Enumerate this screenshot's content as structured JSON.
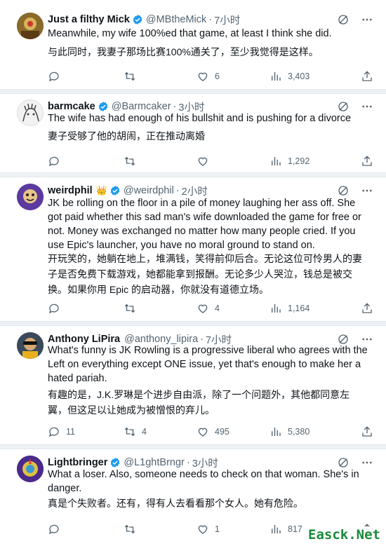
{
  "tweets": [
    {
      "name": "Just a filthy Mick",
      "handle": "@MBtheMick",
      "time": "7小时",
      "text": "Meanwhile, my wife 100%ed that game, at least I think she did.",
      "translation": "与此同时，我妻子那场比赛100%通关了，至少我觉得是这样。",
      "replies": "",
      "retweets": "",
      "likes": "6",
      "views": "3,403"
    },
    {
      "name": "barmcake",
      "handle": "@Barmcaker",
      "time": "3小时",
      "text": "The wife has had enough of his bullshit and is pushing for a divorce",
      "translation": "妻子受够了他的胡闹，正在推动离婚",
      "replies": "",
      "retweets": "",
      "likes": "",
      "views": "1,292"
    },
    {
      "name": "weirdphil",
      "badge": "👑",
      "handle": "@weirdphil",
      "time": "2小时",
      "text": "JK be rolling on the floor in a pile of money laughing her ass off. She got paid whether this sad man's wife downloaded the game for free or not. Money was exchanged no matter how many people cried. If you use Epic's launcher, you have no moral ground to stand on.",
      "translation": "开玩笑的，她躺在地上，堆满钱，笑得前仰后合。无论这位可怜男人的妻子是否免费下载游戏，她都能拿到报酬。无论多少人哭泣，钱总是被交换。如果你用 Epic 的启动器，你就没有道德立场。",
      "replies": "",
      "retweets": "",
      "likes": "4",
      "views": "1,164"
    },
    {
      "name": "Anthony LiPira",
      "handle": "@anthony_lipira",
      "time": "7小时",
      "text": "What's funny is JK Rowling is a progressive liberal who agrees with the Left on everything except ONE issue, yet that's enough to make her a hated pariah.",
      "translation": "有趣的是，J.K.罗琳是个进步自由派，除了一个问题外，其他都同意左翼，但这足以让她成为被憎恨的弃儿。",
      "replies": "11",
      "retweets": "4",
      "likes": "495",
      "views": "5,380"
    },
    {
      "name": "Lightbringer",
      "handle": "@L1ghtBrngr",
      "time": "3小时",
      "text": "What a loser. Also, someone needs to check on that woman. She's in danger.",
      "translation": "真是个失败者。还有，得有人去看看那个女人。她有危险。",
      "replies": "",
      "retweets": "",
      "likes": "1",
      "views": "817"
    }
  ],
  "watermark": "Easck.Net",
  "colors": {
    "verified": "#1d9bf0",
    "muted": "#536471",
    "text": "#0f1419"
  }
}
